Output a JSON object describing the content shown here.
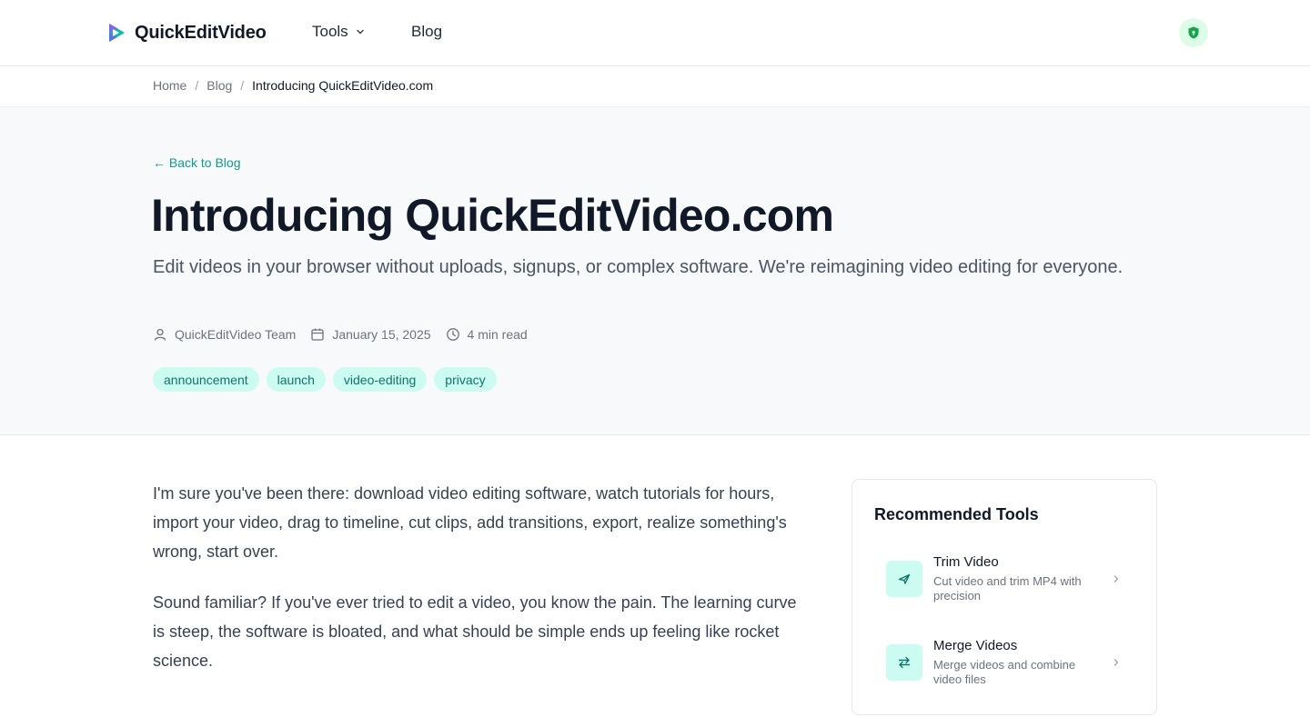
{
  "header": {
    "brand": "QuickEditVideo",
    "nav": {
      "tools": "Tools",
      "blog": "Blog"
    }
  },
  "breadcrumb": {
    "home": "Home",
    "blog": "Blog",
    "current": "Introducing QuickEditVideo.com"
  },
  "hero": {
    "back": "← Back to Blog",
    "title": "Introducing QuickEditVideo.com",
    "subtitle": "Edit videos in your browser without uploads, signups, or complex software. We're reimagining video editing for everyone.",
    "meta": {
      "author": "QuickEditVideo Team",
      "date": "January 15, 2025",
      "read_time": "4 min read"
    },
    "tags": [
      "announcement",
      "launch",
      "video-editing",
      "privacy"
    ]
  },
  "article": {
    "paragraphs": [
      "I'm sure you've been there: download video editing software, watch tutorials for hours, import your video, drag to timeline, cut clips, add transitions, export, realize something's wrong, start over.",
      "Sound familiar? If you've ever tried to edit a video, you know the pain. The learning curve is steep, the software is bloated, and what should be simple ends up feeling like rocket science."
    ]
  },
  "sidebar": {
    "title": "Recommended Tools",
    "tools": [
      {
        "name": "Trim Video",
        "desc": "Cut video and trim MP4 with precision",
        "icon": "scissors-icon"
      },
      {
        "name": "Merge Videos",
        "desc": "Merge videos and combine video files",
        "icon": "merge-arrows-icon"
      }
    ]
  },
  "colors": {
    "accent": "#0f9b8e",
    "tag_bg": "#ccfbf1",
    "tag_text": "#0f766e",
    "hero_bg": "#f8f9fa"
  }
}
